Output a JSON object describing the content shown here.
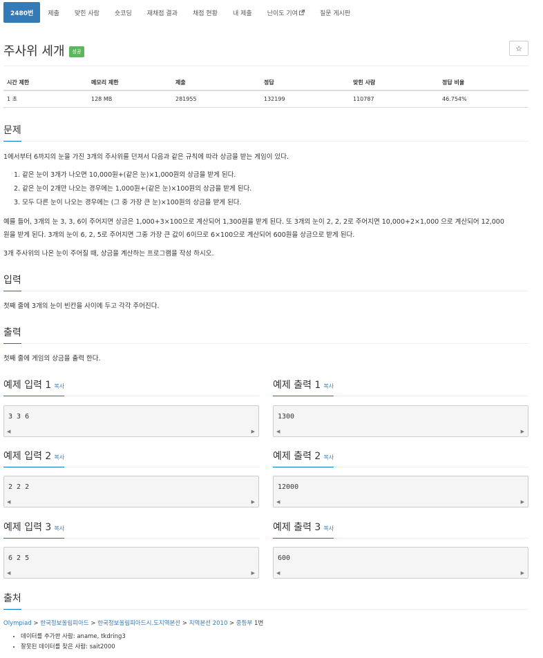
{
  "nav": {
    "items": [
      {
        "label": "2480번"
      },
      {
        "label": "제출"
      },
      {
        "label": "맞힌 사람"
      },
      {
        "label": "숏코딩"
      },
      {
        "label": "재채점 결과"
      },
      {
        "label": "채점 현황"
      },
      {
        "label": "내 제출"
      },
      {
        "label": "난이도 기여"
      },
      {
        "label": "질문 게시판"
      }
    ]
  },
  "problem": {
    "title": "주사위 세개",
    "badge": "성공",
    "star": "☆"
  },
  "stats": {
    "headers": [
      "시간 제한",
      "메모리 제한",
      "제출",
      "정답",
      "맞힌 사람",
      "정답 비율"
    ],
    "values": [
      "1 초",
      "128 MB",
      "281955",
      "132199",
      "110787",
      "46.754%"
    ]
  },
  "sections": {
    "problem": "문제",
    "input": "입력",
    "output": "출력",
    "source": "출처"
  },
  "description": {
    "intro": "1에서부터 6까지의 눈을 가진 3개의 주사위를 던져서 다음과 같은 규칙에 따라 상금을 받는 게임이 있다.",
    "rules": [
      "1. 같은 눈이 3개가 나오면 10,000원+(같은 눈)×1,000원의 상금을 받게 된다.",
      "2. 같은 눈이 2개만 나오는 경우에는 1,000원+(같은 눈)×100원의 상금을 받게 된다.",
      "3. 모두 다른 눈이 나오는 경우에는 (그 중 가장 큰 눈)×100원의 상금을 받게 된다."
    ],
    "example_line1": "예를 들어, 3개의 눈 3, 3, 6이 주어지면 상금은 1,000+3×100으로 계산되어 1,300원을 받게 된다. 또 3개의 눈이 2, 2, 2로 주어지면 10,000+2×1,000 으로 계산되어 12,000",
    "example_line2": "원을 받게 된다. 3개의 눈이 6, 2, 5로 주어지면 그중 가장 큰 값이 6이므로 6×100으로 계산되어 600원을 상금으로 받게 된다.",
    "task": "3개 주사위의 나온 눈이 주어질 때, 상금을 계산하는 프로그램을 작성 하시오."
  },
  "input_text": "첫째 줄에 3개의 눈이 빈칸을 사이에 두고 각각 주어진다.",
  "output_text": "첫째 줄에 게임의 상금을 출력 한다.",
  "samples": [
    {
      "in_title": "예제 입력 1",
      "out_title": "예제 출력 1",
      "input": "3 3 6",
      "output": "1300"
    },
    {
      "in_title": "예제 입력 2",
      "out_title": "예제 출력 2",
      "input": "2 2 2",
      "output": "12000"
    },
    {
      "in_title": "예제 입력 3",
      "out_title": "예제 출력 3",
      "input": "6 2 5",
      "output": "600"
    }
  ],
  "copy_label": "복사",
  "scroll": {
    "left": "◀",
    "right": "▶"
  },
  "source": {
    "path": [
      "Olympiad",
      "한국정보올림피아드",
      "한국정보올림피아드시.도지역본선",
      "지역본선 2010",
      "중등부"
    ],
    "sep": " > ",
    "tail": " 1번",
    "credits": [
      "데이터를 추가한 사람: aname, tkdring3",
      "잘못된 데이터를 찾은 사람: sait2000"
    ]
  }
}
